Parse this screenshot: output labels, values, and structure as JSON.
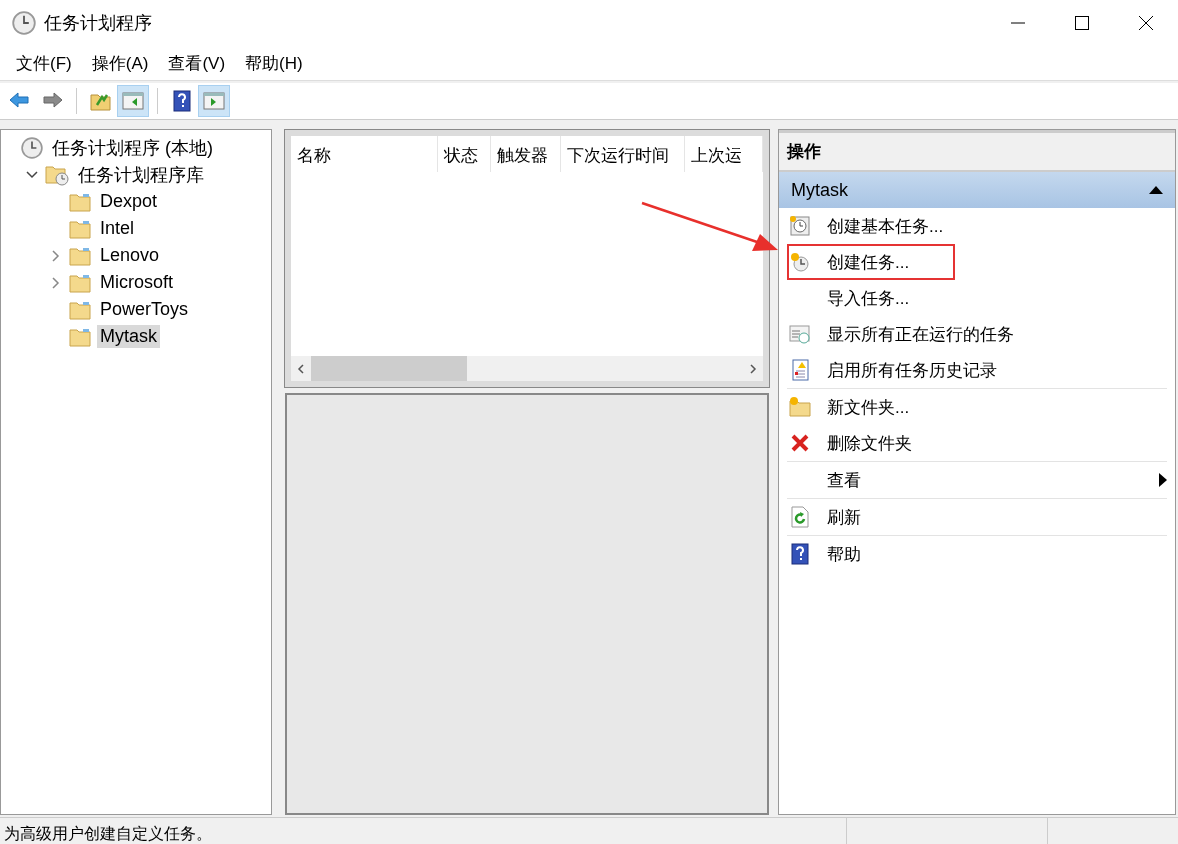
{
  "window": {
    "title": "任务计划程序"
  },
  "menu": [
    "文件(F)",
    "操作(A)",
    "查看(V)",
    "帮助(H)"
  ],
  "toolbar": [
    [
      {
        "kind": "back",
        "pressed": false
      },
      {
        "kind": "forward",
        "pressed": false
      }
    ],
    [
      {
        "kind": "upfolder",
        "pressed": false
      },
      {
        "kind": "treepane",
        "pressed": true
      }
    ],
    [
      {
        "kind": "help",
        "pressed": false
      },
      {
        "kind": "actionpane",
        "pressed": true
      }
    ]
  ],
  "tree": [
    {
      "label": "任务计划程序 (本地)",
      "kind": "scheduler",
      "selected": false,
      "children": [
        {
          "label": "任务计划程序库",
          "kind": "library",
          "expanded": true,
          "selected": false,
          "children": [
            {
              "label": "Dexpot",
              "kind": "folder",
              "selected": false
            },
            {
              "label": "Intel",
              "kind": "folder",
              "selected": false
            },
            {
              "label": "Lenovo",
              "kind": "folder",
              "expanded": false,
              "selected": false
            },
            {
              "label": "Microsoft",
              "kind": "folder",
              "expanded": false,
              "selected": false
            },
            {
              "label": "PowerToys",
              "kind": "folder",
              "selected": false
            },
            {
              "label": "Mytask",
              "kind": "folder",
              "selected": true
            }
          ]
        }
      ]
    }
  ],
  "table": {
    "columns": [
      "名称",
      "状态",
      "触发器",
      "下次运行时间",
      "上次运"
    ]
  },
  "actions": {
    "title": "操作",
    "section": {
      "title": "Mytask",
      "expanded": true
    },
    "items": [
      {
        "label": "创建基本任务...",
        "kind": "basictask",
        "separator_before": false,
        "highlighted": false
      },
      {
        "label": "创建任务...",
        "kind": "task",
        "separator_before": false,
        "highlighted": true
      },
      {
        "label": "导入任务...",
        "kind": "plain",
        "separator_before": false,
        "highlighted": false
      },
      {
        "label": "显示所有正在运行的任务",
        "kind": "running",
        "separator_before": false,
        "highlighted": false
      },
      {
        "label": "启用所有任务历史记录",
        "kind": "history",
        "separator_before": false,
        "highlighted": false
      },
      {
        "label": "新文件夹...",
        "kind": "newfolder",
        "separator_before": true,
        "highlighted": false
      },
      {
        "label": "删除文件夹",
        "kind": "delete",
        "separator_before": false,
        "highlighted": false
      },
      {
        "label": "查看",
        "kind": "submenu",
        "separator_before": true,
        "highlighted": false
      },
      {
        "label": "刷新",
        "kind": "refresh",
        "separator_before": true,
        "highlighted": false
      },
      {
        "label": "帮助",
        "kind": "help",
        "separator_before": true,
        "highlighted": false
      }
    ]
  },
  "status_bar": {
    "text": "为高级用户创建自定义任务。"
  }
}
